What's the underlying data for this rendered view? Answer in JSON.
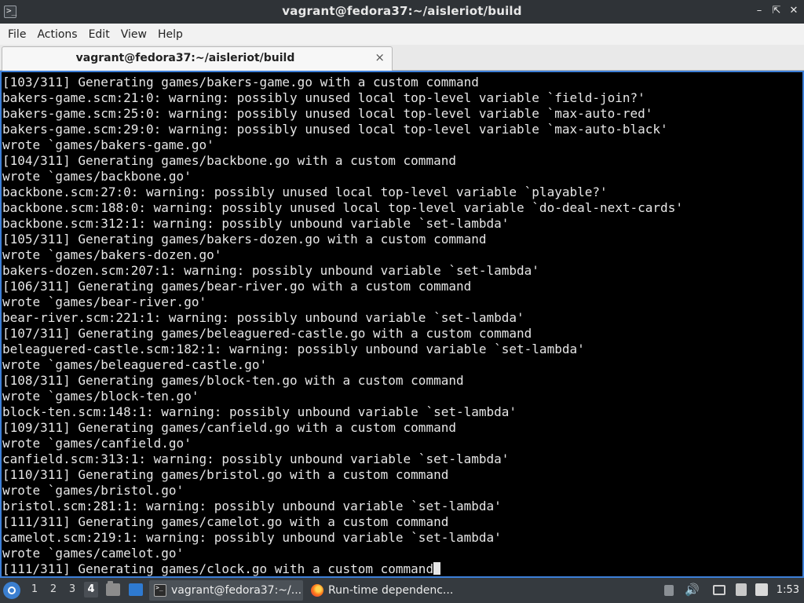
{
  "window": {
    "title": "vagrant@fedora37:~/aisleriot/build",
    "controls": [
      "minimize-icon",
      "maximize-icon",
      "close-icon"
    ]
  },
  "menu": [
    "File",
    "Actions",
    "Edit",
    "View",
    "Help"
  ],
  "tab": {
    "label": "vagrant@fedora37:~/aisleriot/build",
    "close": "×"
  },
  "terminal": {
    "lines": [
      "[103/311] Generating games/bakers-game.go with a custom command",
      "bakers-game.scm:21:0: warning: possibly unused local top-level variable `field-join?'",
      "bakers-game.scm:25:0: warning: possibly unused local top-level variable `max-auto-red'",
      "bakers-game.scm:29:0: warning: possibly unused local top-level variable `max-auto-black'",
      "wrote `games/bakers-game.go'",
      "[104/311] Generating games/backbone.go with a custom command",
      "wrote `games/backbone.go'",
      "backbone.scm:27:0: warning: possibly unused local top-level variable `playable?'",
      "backbone.scm:188:0: warning: possibly unused local top-level variable `do-deal-next-cards'",
      "backbone.scm:312:1: warning: possibly unbound variable `set-lambda'",
      "[105/311] Generating games/bakers-dozen.go with a custom command",
      "wrote `games/bakers-dozen.go'",
      "bakers-dozen.scm:207:1: warning: possibly unbound variable `set-lambda'",
      "[106/311] Generating games/bear-river.go with a custom command",
      "wrote `games/bear-river.go'",
      "bear-river.scm:221:1: warning: possibly unbound variable `set-lambda'",
      "[107/311] Generating games/beleaguered-castle.go with a custom command",
      "beleaguered-castle.scm:182:1: warning: possibly unbound variable `set-lambda'",
      "wrote `games/beleaguered-castle.go'",
      "[108/311] Generating games/block-ten.go with a custom command",
      "wrote `games/block-ten.go'",
      "block-ten.scm:148:1: warning: possibly unbound variable `set-lambda'",
      "[109/311] Generating games/canfield.go with a custom command",
      "wrote `games/canfield.go'",
      "canfield.scm:313:1: warning: possibly unbound variable `set-lambda'",
      "[110/311] Generating games/bristol.go with a custom command",
      "wrote `games/bristol.go'",
      "bristol.scm:281:1: warning: possibly unbound variable `set-lambda'",
      "[111/311] Generating games/camelot.go with a custom command",
      "camelot.scm:219:1: warning: possibly unbound variable `set-lambda'",
      "wrote `games/camelot.go'",
      "[111/311] Generating games/clock.go with a custom command"
    ]
  },
  "taskbar": {
    "workspaces": [
      "1",
      "2",
      "3",
      "4"
    ],
    "active_workspace": "4",
    "tasks": [
      {
        "label": "vagrant@fedora37:~/...",
        "icon": "terminal-icon",
        "active": true
      },
      {
        "label": "Run-time dependenc...",
        "icon": "firefox-icon",
        "active": false
      }
    ],
    "clock": "1:53"
  }
}
